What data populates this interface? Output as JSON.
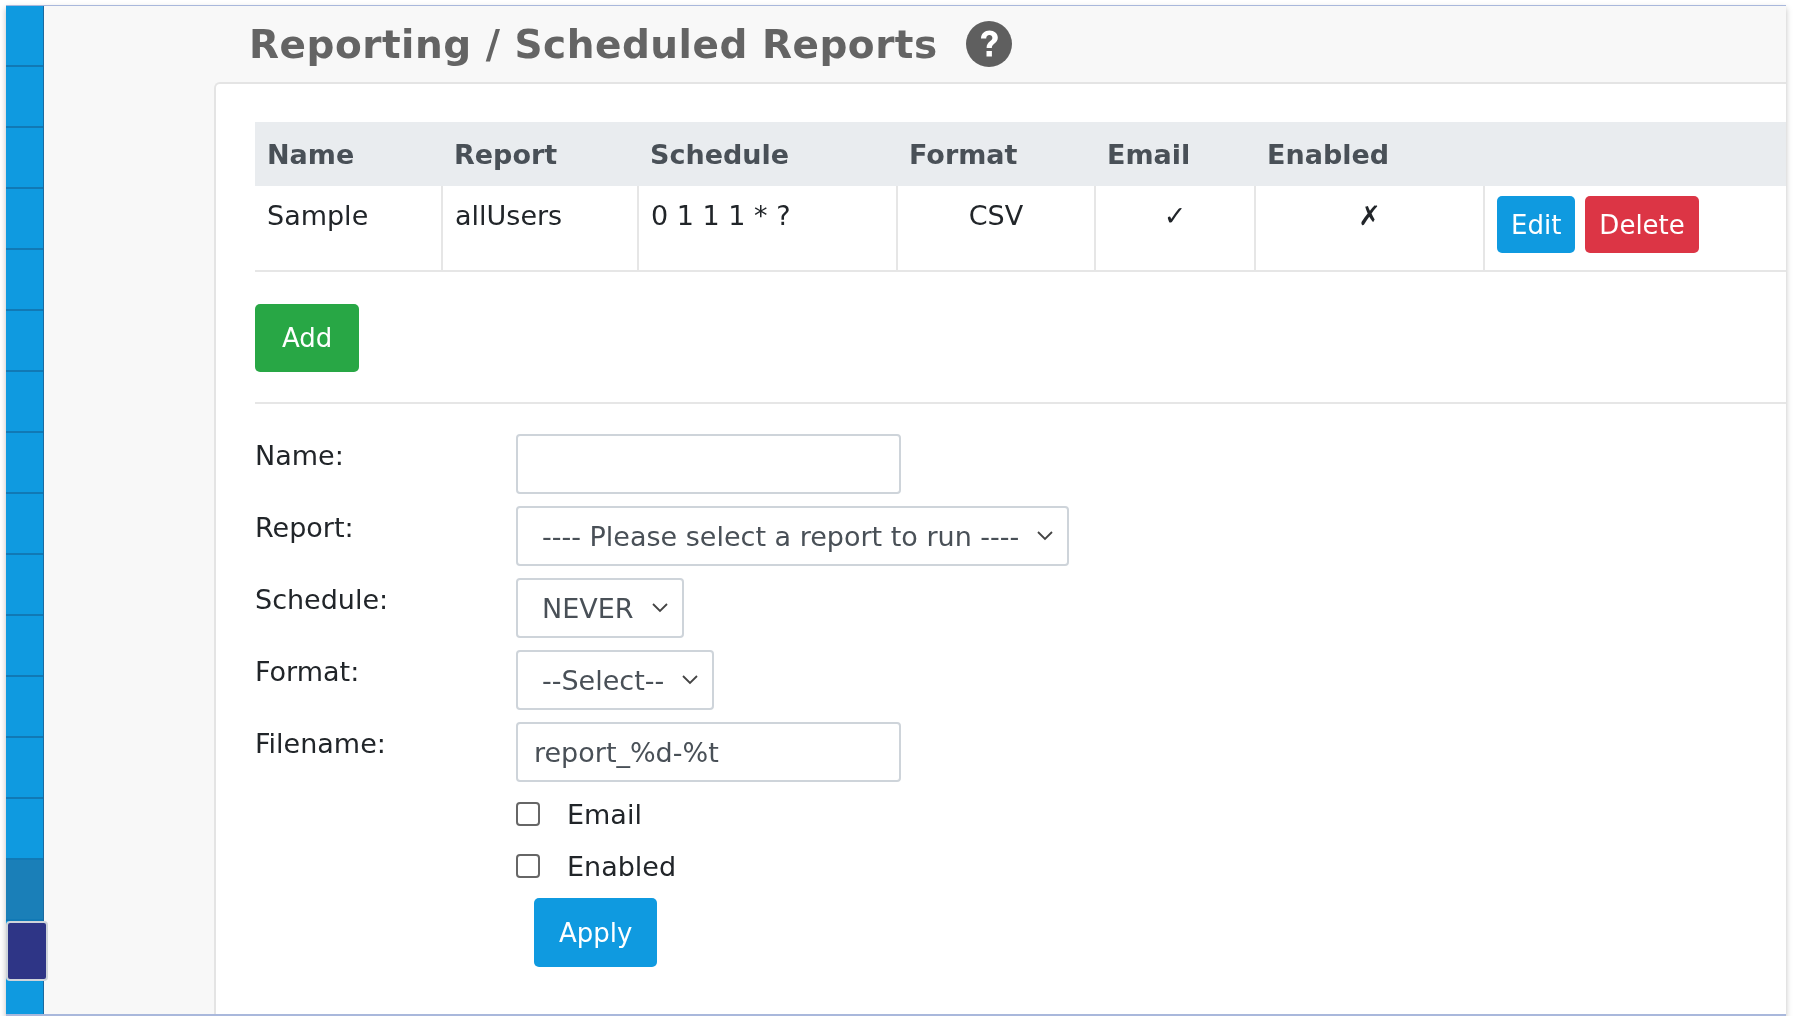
{
  "sidebar": {
    "items": [
      {
        "selected": false,
        "hovered": false
      },
      {
        "selected": false,
        "hovered": false
      },
      {
        "selected": false,
        "hovered": false
      },
      {
        "selected": false,
        "hovered": false
      },
      {
        "selected": false,
        "hovered": false
      },
      {
        "selected": false,
        "hovered": false
      },
      {
        "selected": false,
        "hovered": false
      },
      {
        "selected": false,
        "hovered": false
      },
      {
        "selected": false,
        "hovered": false
      },
      {
        "selected": false,
        "hovered": false
      },
      {
        "selected": false,
        "hovered": false
      },
      {
        "selected": false,
        "hovered": false
      },
      {
        "selected": false,
        "hovered": false
      },
      {
        "selected": false,
        "hovered": false
      },
      {
        "selected": false,
        "hovered": true
      },
      {
        "selected": true,
        "hovered": false
      }
    ]
  },
  "page_title": "Reporting / Scheduled Reports",
  "table": {
    "columns": [
      "Name",
      "Report",
      "Schedule",
      "Format",
      "Email",
      "Enabled"
    ],
    "rows": [
      {
        "cells": [
          "Sample",
          "allUsers",
          "0 1 1 1 * ?",
          "CSV",
          "✓",
          "✗"
        ],
        "actions": [
          {
            "label": "Edit",
            "kind": "primary"
          },
          {
            "label": "Delete",
            "kind": "danger"
          }
        ]
      }
    ]
  },
  "add_button": "Add",
  "form": {
    "fields": [
      {
        "label": "Name:",
        "kind": "text"
      },
      {
        "label": "Report:",
        "kind": "select",
        "value": "---- Please select a report to run ----"
      },
      {
        "label": "Schedule:",
        "kind": "select",
        "value": "NEVER"
      },
      {
        "label": "Format:",
        "kind": "select",
        "value": "--Select--"
      },
      {
        "label": "Filename:",
        "kind": "text",
        "value": "report_%d-%t"
      }
    ],
    "checkboxes": [
      {
        "label": "Email",
        "checked": false
      },
      {
        "label": "Enabled",
        "checked": false
      }
    ],
    "apply_button": "Apply"
  }
}
